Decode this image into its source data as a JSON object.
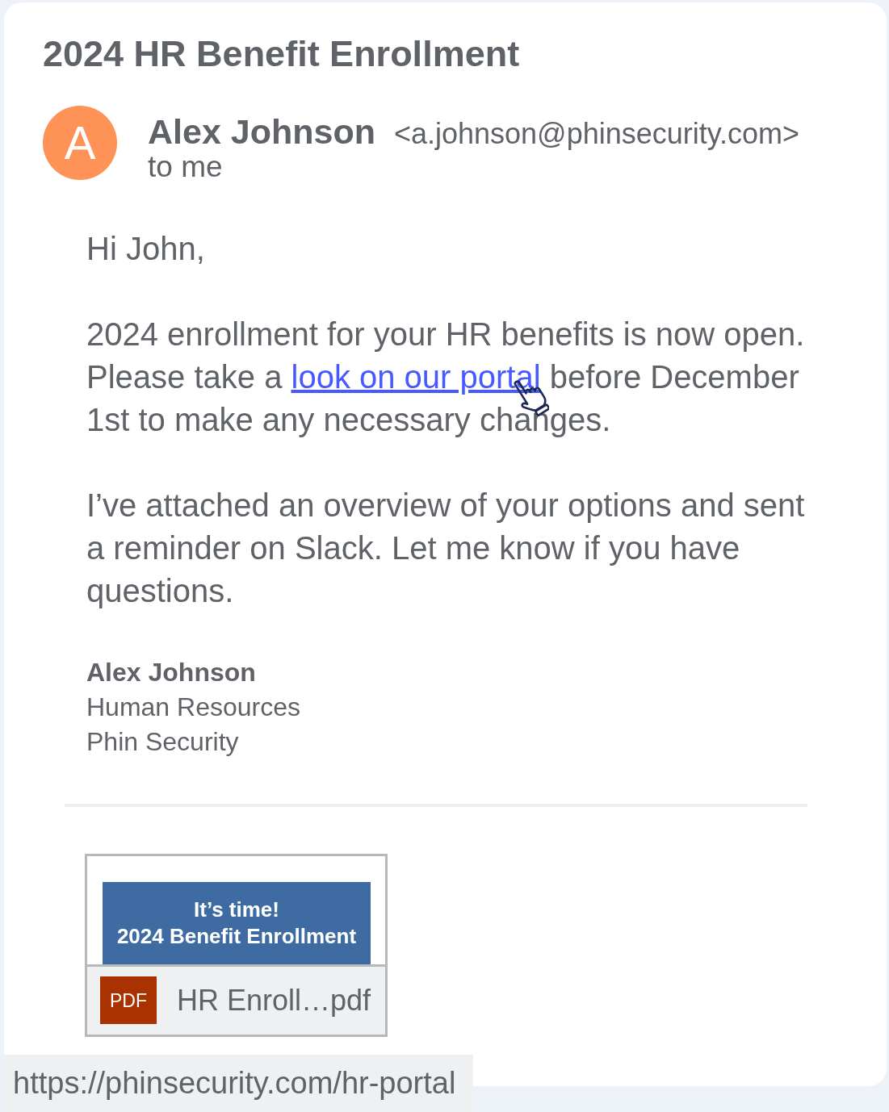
{
  "email": {
    "subject": "2024 HR Benefit Enrollment",
    "sender": {
      "avatar_letter": "A",
      "name": "Alex Johnson",
      "address": "<a.johnson@phinsecurity.com>",
      "recipient": "to me"
    },
    "body": [
      {
        "parts": [
          {
            "kind": "text",
            "text": "Hi John,"
          }
        ]
      },
      {
        "parts": [
          {
            "kind": "text",
            "text": "2024 enrollment for your HR benefits is now open. Please take a "
          },
          {
            "kind": "link",
            "text": "look on our portal",
            "hovered": true
          },
          {
            "kind": "text",
            "text": " before December 1st to make any necessary changes."
          }
        ]
      },
      {
        "parts": [
          {
            "kind": "text",
            "text": "I’ve attached an overview of your options and sent a reminder on Slack. Let me know if you have questions."
          }
        ]
      }
    ],
    "signature": {
      "name": "Alex Johnson",
      "lines": [
        "Human Resources",
        "Phin Security"
      ]
    },
    "attachments": [
      {
        "preview_lines": [
          "It’s time!",
          "2024 Benefit Enrollment"
        ],
        "file_type": "PDF",
        "filename": "HR Enroll…pdf"
      }
    ]
  },
  "status_bar": {
    "url": "https://phinsecurity.com/hr-portal"
  }
}
